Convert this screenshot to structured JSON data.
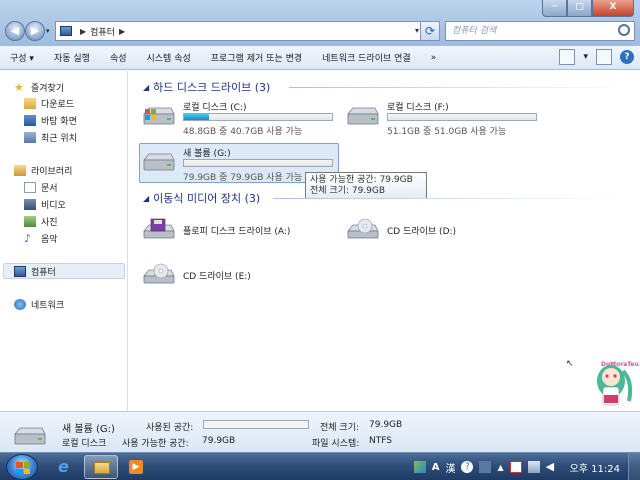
{
  "window": {
    "address_crumb": "컴퓨터",
    "search_placeholder": "컴퓨터 검색",
    "min_label": "─",
    "max_label": "□",
    "close_label": "X"
  },
  "toolbar": {
    "organize": "구성 ▾",
    "autoplay": "자동 실행",
    "properties": "속성",
    "system_properties": "시스템 속성",
    "uninstall": "프로그램 제거 또는 변경",
    "map_drive": "네트워크 드라이브 연결",
    "more": "»",
    "view_dropdown": "▾",
    "help": "?"
  },
  "sidebar": {
    "favorites": "즐겨찾기",
    "favorites_items": [
      "다운로드",
      "바탕 화면",
      "최근 위치"
    ],
    "libraries": "라이브러리",
    "libraries_items": [
      "문서",
      "비디오",
      "사진",
      "음악"
    ],
    "computer": "컴퓨터",
    "network": "네트워크"
  },
  "main": {
    "hard_disks_header": "하드 디스크 드라이브 (3)",
    "removable_header": "이동식 미디어 장치 (3)",
    "drives": [
      {
        "name": "로컬 디스크 (C:)",
        "info": "48.8GB 중 40.7GB 사용 가능",
        "used_fraction": 0.17
      },
      {
        "name": "로컬 디스크 (F:)",
        "info": "51.1GB 중 51.0GB 사용 가능",
        "used_fraction": 0.002
      },
      {
        "name": "새 볼륨 (G:)",
        "info": "79.9GB 중 79.9GB 사용 가능",
        "used_fraction": 0.0
      }
    ],
    "removable": [
      {
        "name": "플로피 디스크 드라이브 (A:)"
      },
      {
        "name": "CD 드라이브 (D:)"
      },
      {
        "name": "CD 드라이브 (E:)"
      }
    ],
    "tooltip_line1": "사용 가능한 공간: 79.9GB",
    "tooltip_line2": "전체 크기: 79.9GB",
    "watermark": "DoMoraTeu"
  },
  "details": {
    "name": "새 볼륨 (G:)",
    "type": "로컬 디스크",
    "used_label": "사용된 공간:",
    "free_label": "사용 가능한 공간:",
    "free_value": "79.9GB",
    "total_label": "전체 크기:",
    "total_value": "79.9GB",
    "fs_label": "파일 시스템:",
    "fs_value": "NTFS"
  },
  "taskbar": {
    "ime_a": "A",
    "ime_han": "漢",
    "clock": "오후 11:24"
  },
  "colors": {
    "accent": "#1e3287",
    "drive_fill": "#1a8ac7",
    "selection": "#dbe9f9"
  }
}
